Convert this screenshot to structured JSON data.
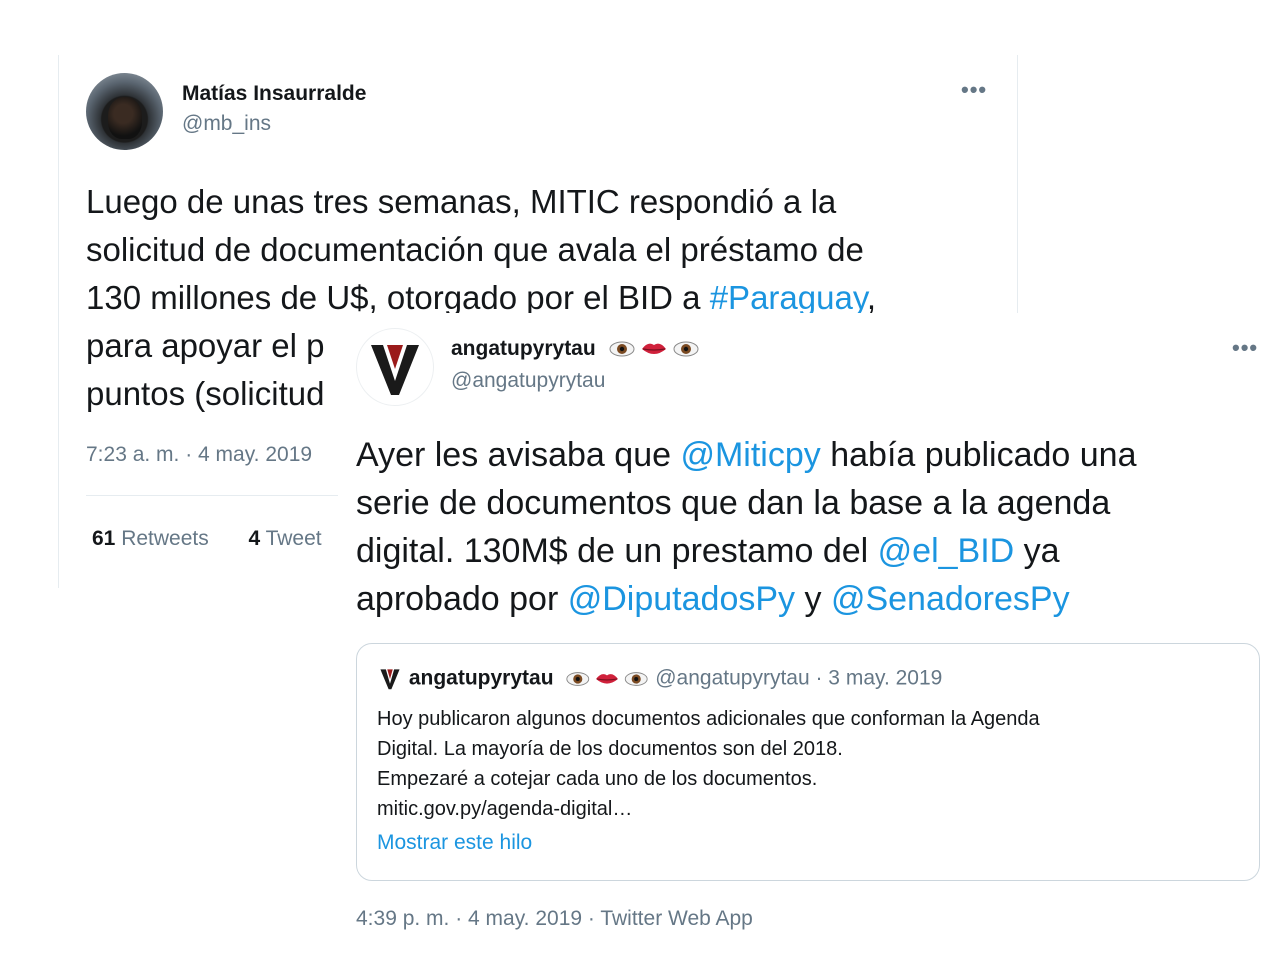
{
  "tweet1": {
    "display_name": "Matías Insaurralde",
    "handle": "@mb_ins",
    "more_icon": "•••",
    "text_lines": [
      {
        "parts": [
          {
            "t": "Luego de unas tres semanas, MITIC respondió a la"
          }
        ]
      },
      {
        "parts": [
          {
            "t": "solicitud de documentación que avala el préstamo de"
          }
        ]
      },
      {
        "parts": [
          {
            "t": "130 millones de U$, otorgado por el BID a "
          },
          {
            "t": "#Paraguay",
            "link": true
          },
          {
            "t": ","
          }
        ]
      },
      {
        "parts": [
          {
            "t": "para apoyar el p"
          }
        ]
      },
      {
        "parts": [
          {
            "t": "puntos (solicitud"
          }
        ]
      }
    ],
    "timestamp": "7:23 a. m. · 4 may. 2019",
    "retweets_count": "61",
    "retweets_label": "Retweets",
    "likes_count": "4",
    "likes_label": "Tweet"
  },
  "tweet2": {
    "display_name": "angatupyrytau",
    "name_emojis": [
      "eye-icon",
      "lips-icon",
      "eye-icon"
    ],
    "handle": "@angatupyrytau",
    "more_icon": "•••",
    "text_lines": [
      {
        "parts": [
          {
            "t": "Ayer les avisaba que "
          },
          {
            "t": "@Miticpy",
            "link": true
          },
          {
            "t": " había publicado una"
          }
        ]
      },
      {
        "parts": [
          {
            "t": "serie de documentos que dan la base a la agenda"
          }
        ]
      },
      {
        "parts": [
          {
            "t": "digital. 130M$ de un prestamo del "
          },
          {
            "t": "@el_BID",
            "link": true
          },
          {
            "t": " ya"
          }
        ]
      },
      {
        "parts": [
          {
            "t": "aprobado por "
          },
          {
            "t": "@DiputadosPy",
            "link": true
          },
          {
            "t": " y "
          },
          {
            "t": "@SenadoresPy",
            "link": true
          }
        ]
      }
    ],
    "quoted": {
      "display_name": "angatupyrytau",
      "handle_date": "@angatupyrytau · 3 may. 2019",
      "body_lines": [
        "Hoy publicaron algunos documentos adicionales que conforman la Agenda",
        "Digital. La mayoría de los documentos son del 2018.",
        "Empezaré a cotejar cada uno de los documentos.",
        "mitic.gov.py/agenda-digital…"
      ],
      "show_thread": "Mostrar este hilo"
    },
    "timestamp": "4:39 p. m. · 4 may. 2019 · Twitter Web App"
  },
  "colors": {
    "link": "#1b95e0",
    "secondary_text": "#657786",
    "primary_text": "#14171a",
    "border": "#ccd6dd",
    "logo_red": "#9b1b1b"
  }
}
